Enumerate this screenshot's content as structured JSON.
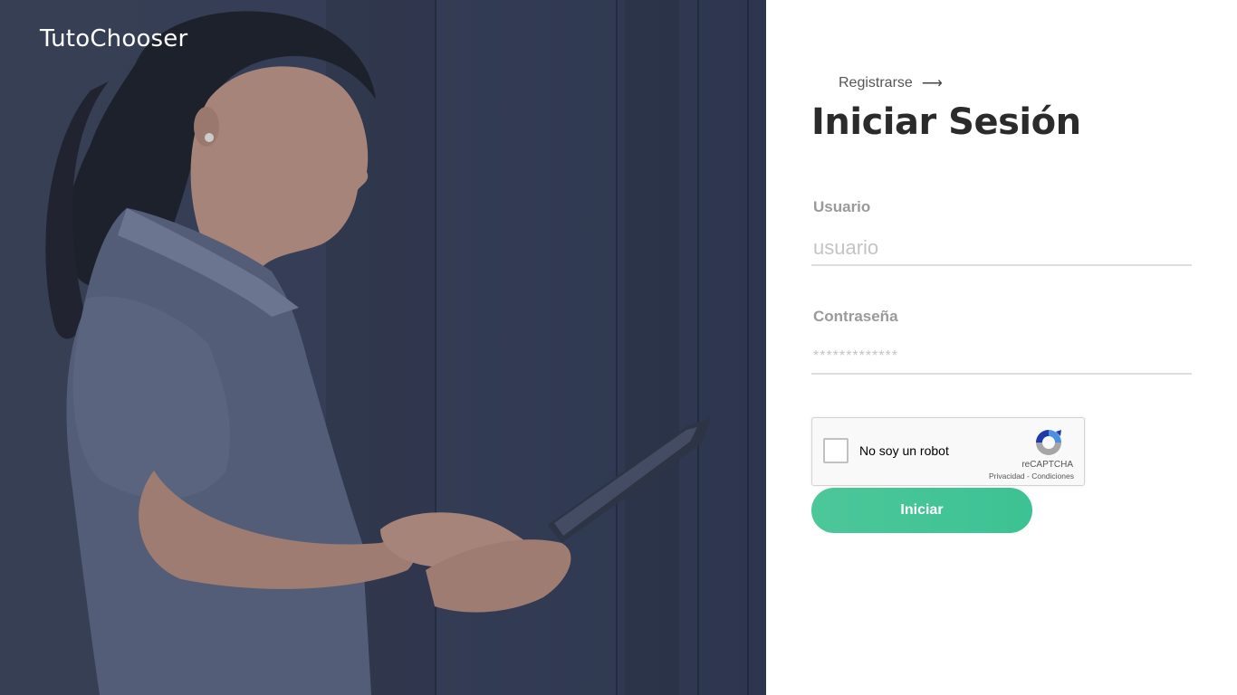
{
  "brand": {
    "name": "TutoChooser"
  },
  "header": {
    "register_label": "Registrarse",
    "register_arrow": "⟶"
  },
  "form": {
    "title": "Iniciar Sesión",
    "username": {
      "label": "Usuario",
      "placeholder": "usuario"
    },
    "password": {
      "label": "Contraseña",
      "placeholder": "*************"
    },
    "submit_label": "Iniciar"
  },
  "captcha": {
    "label": "No soy un robot",
    "brand": "reCAPTCHA",
    "privacy": "Privacidad",
    "separator": " - ",
    "terms": "Condiciones"
  },
  "colors": {
    "accent": "#3cc294",
    "title": "#2b2b2b",
    "hero_background": "#39415a"
  },
  "icons": {
    "register": "arrow-right-icon",
    "captcha": "recaptcha-icon"
  }
}
